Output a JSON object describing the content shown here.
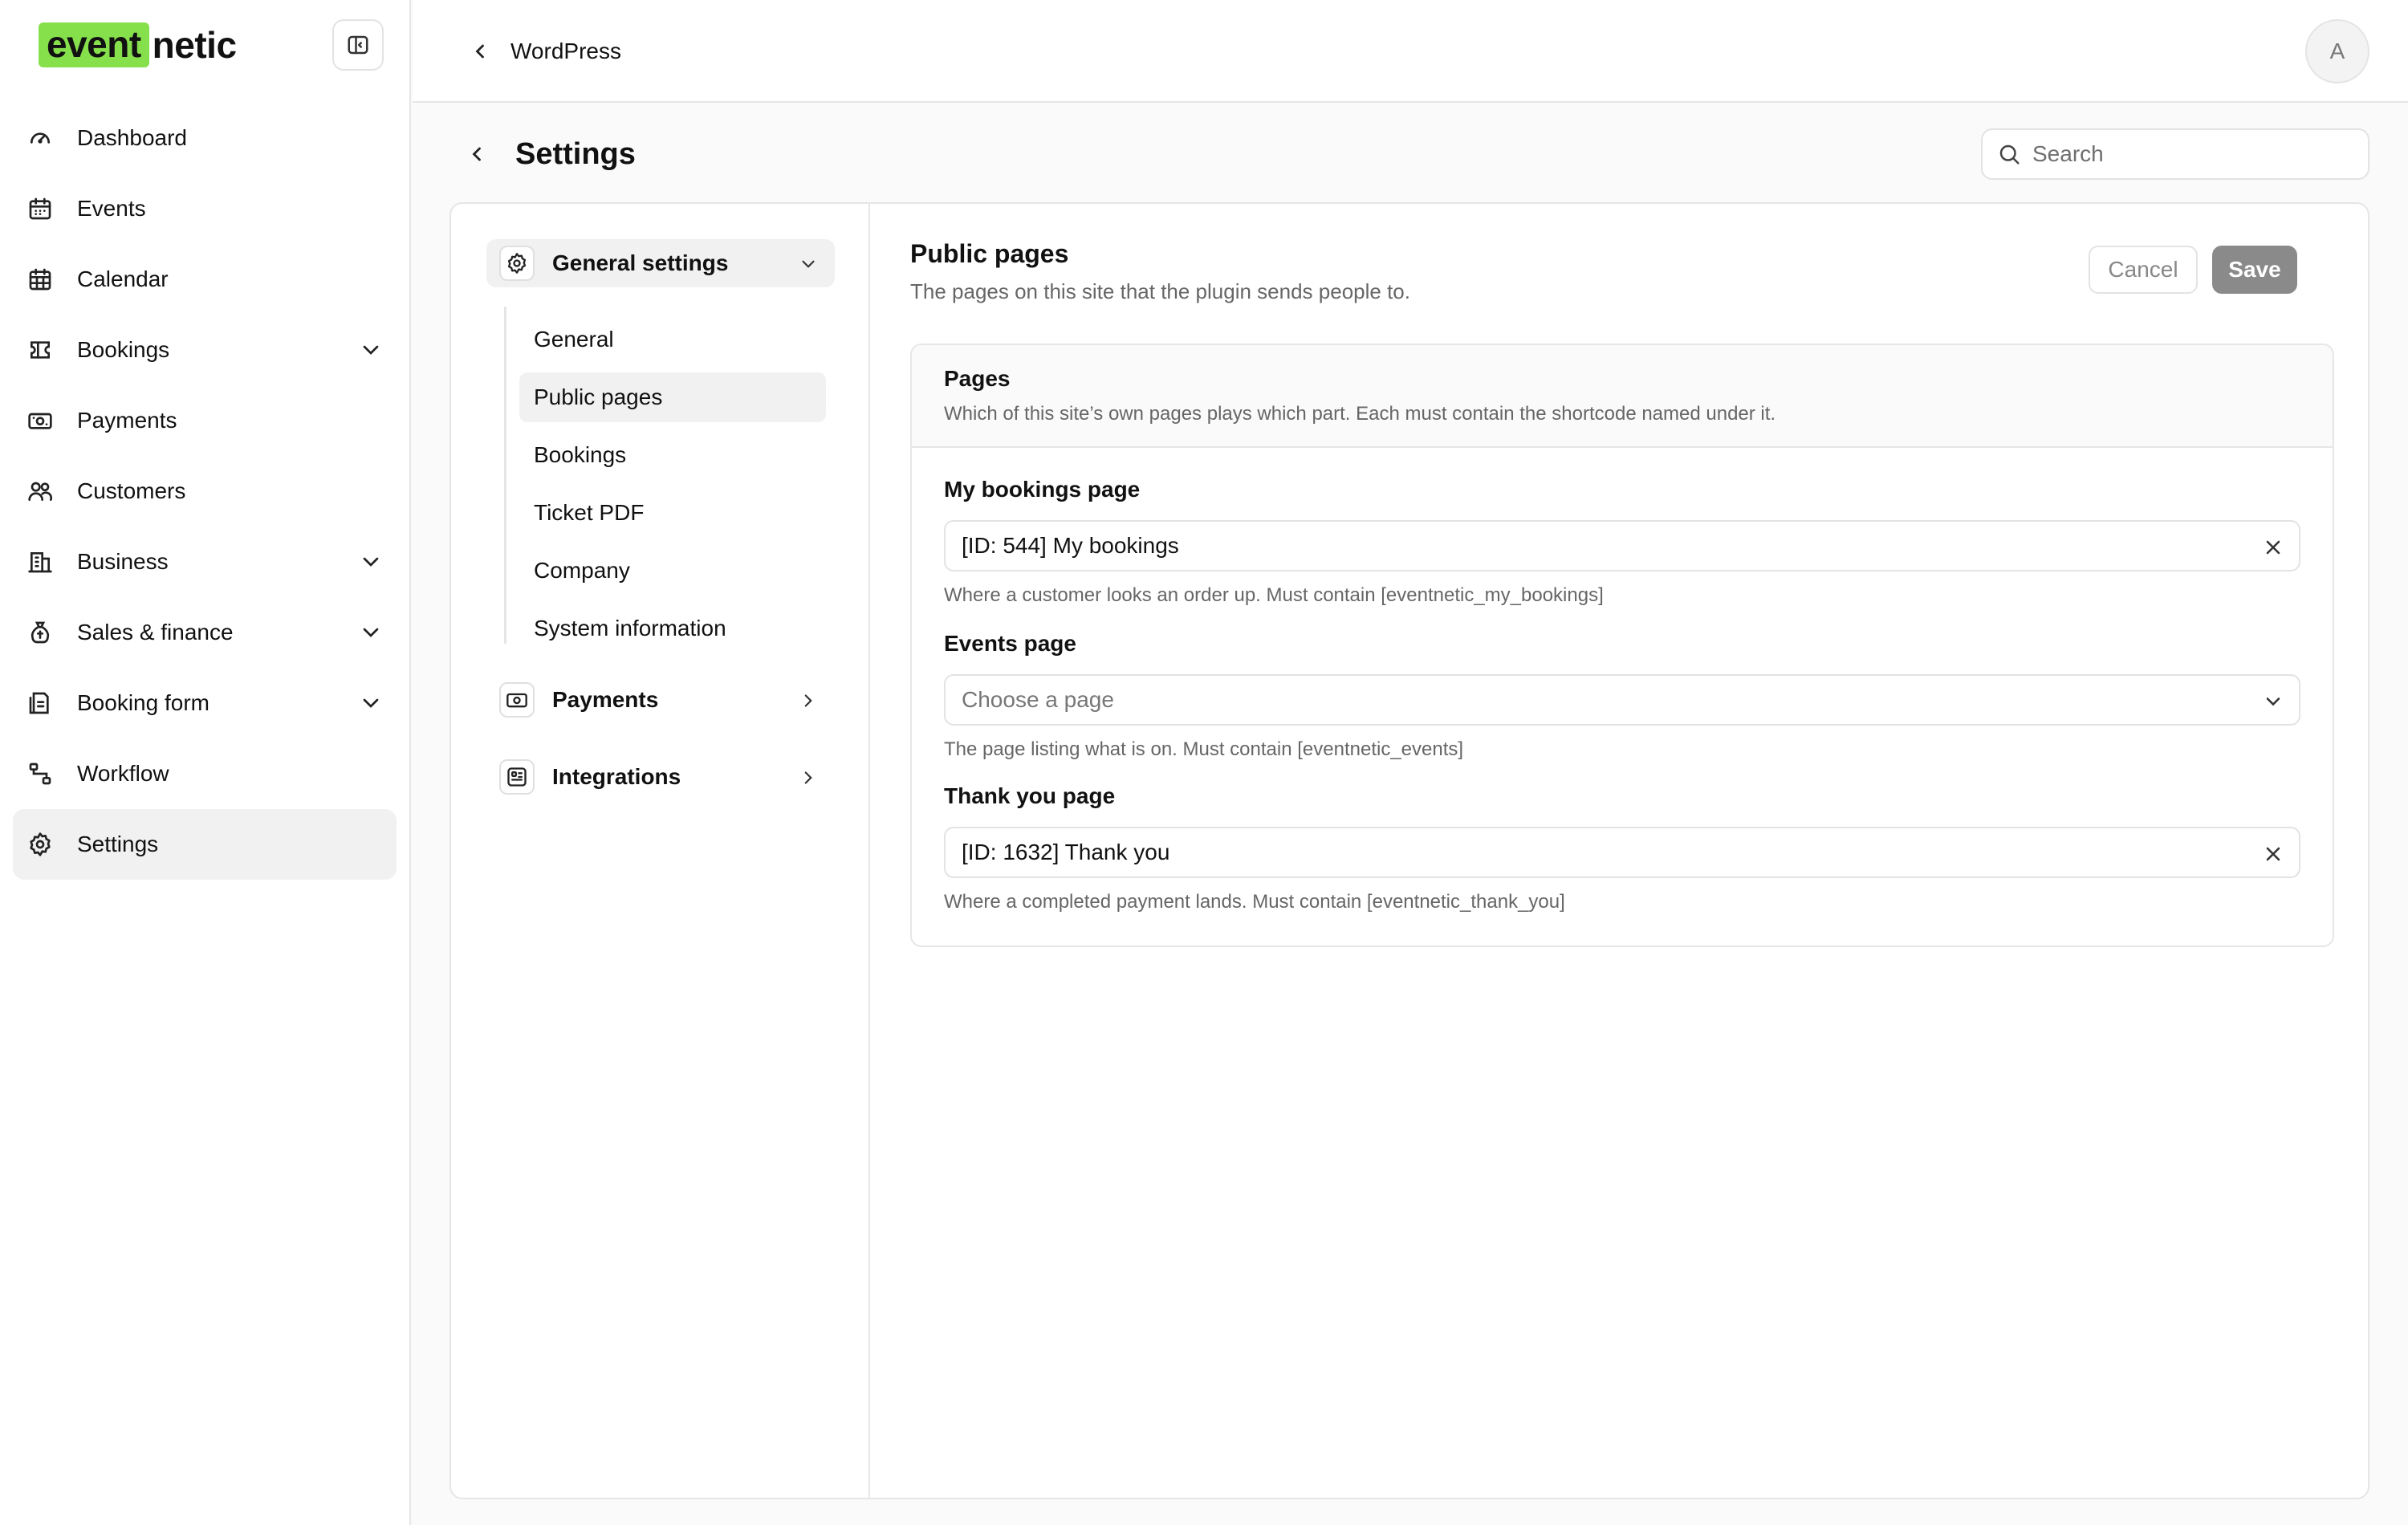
{
  "brand": {
    "part1": "event",
    "part2": "netic",
    "accent": "#86e04c"
  },
  "sidebar": {
    "items": [
      {
        "label": "Dashboard",
        "icon": "gauge-icon",
        "expandable": false
      },
      {
        "label": "Events",
        "icon": "calendar-icon",
        "expandable": false
      },
      {
        "label": "Calendar",
        "icon": "calendar-grid-icon",
        "expandable": false
      },
      {
        "label": "Bookings",
        "icon": "ticket-icon",
        "expandable": true
      },
      {
        "label": "Payments",
        "icon": "banknote-icon",
        "expandable": false
      },
      {
        "label": "Customers",
        "icon": "users-icon",
        "expandable": false
      },
      {
        "label": "Business",
        "icon": "building-icon",
        "expandable": true
      },
      {
        "label": "Sales & finance",
        "icon": "money-bag-icon",
        "expandable": true
      },
      {
        "label": "Booking form",
        "icon": "form-icon",
        "expandable": true
      },
      {
        "label": "Workflow",
        "icon": "workflow-icon",
        "expandable": false
      },
      {
        "label": "Settings",
        "icon": "gear-icon",
        "expandable": false,
        "active": true
      }
    ]
  },
  "topbar": {
    "back_label": "WordPress",
    "avatar_initial": "A"
  },
  "page": {
    "title": "Settings"
  },
  "search": {
    "placeholder": "Search"
  },
  "settings_nav": {
    "general_group": "General settings",
    "sub_items": [
      "General",
      "Public pages",
      "Bookings",
      "Ticket PDF",
      "Company",
      "System information"
    ],
    "active_sub": "Public pages",
    "payments_group": "Payments",
    "integrations_group": "Integrations"
  },
  "section": {
    "title": "Public pages",
    "description": "The pages on this site that the plugin sends people to.",
    "cancel_label": "Cancel",
    "save_label": "Save"
  },
  "card": {
    "title": "Pages",
    "description": "Which of this site’s own pages plays which part. Each must contain the shortcode named under it.",
    "fields": [
      {
        "label": "My bookings page",
        "value": "[ID: 544] My bookings",
        "control": "clearable",
        "help": "Where a customer looks an order up. Must contain [eventnetic_my_bookings]"
      },
      {
        "label": "Events page",
        "value": "Choose a page",
        "control": "dropdown",
        "help": "The page listing what is on. Must contain [eventnetic_events]"
      },
      {
        "label": "Thank you page",
        "value": "[ID: 1632] Thank you",
        "control": "clearable",
        "help": "Where a completed payment lands. Must contain [eventnetic_thank_you]"
      }
    ]
  }
}
